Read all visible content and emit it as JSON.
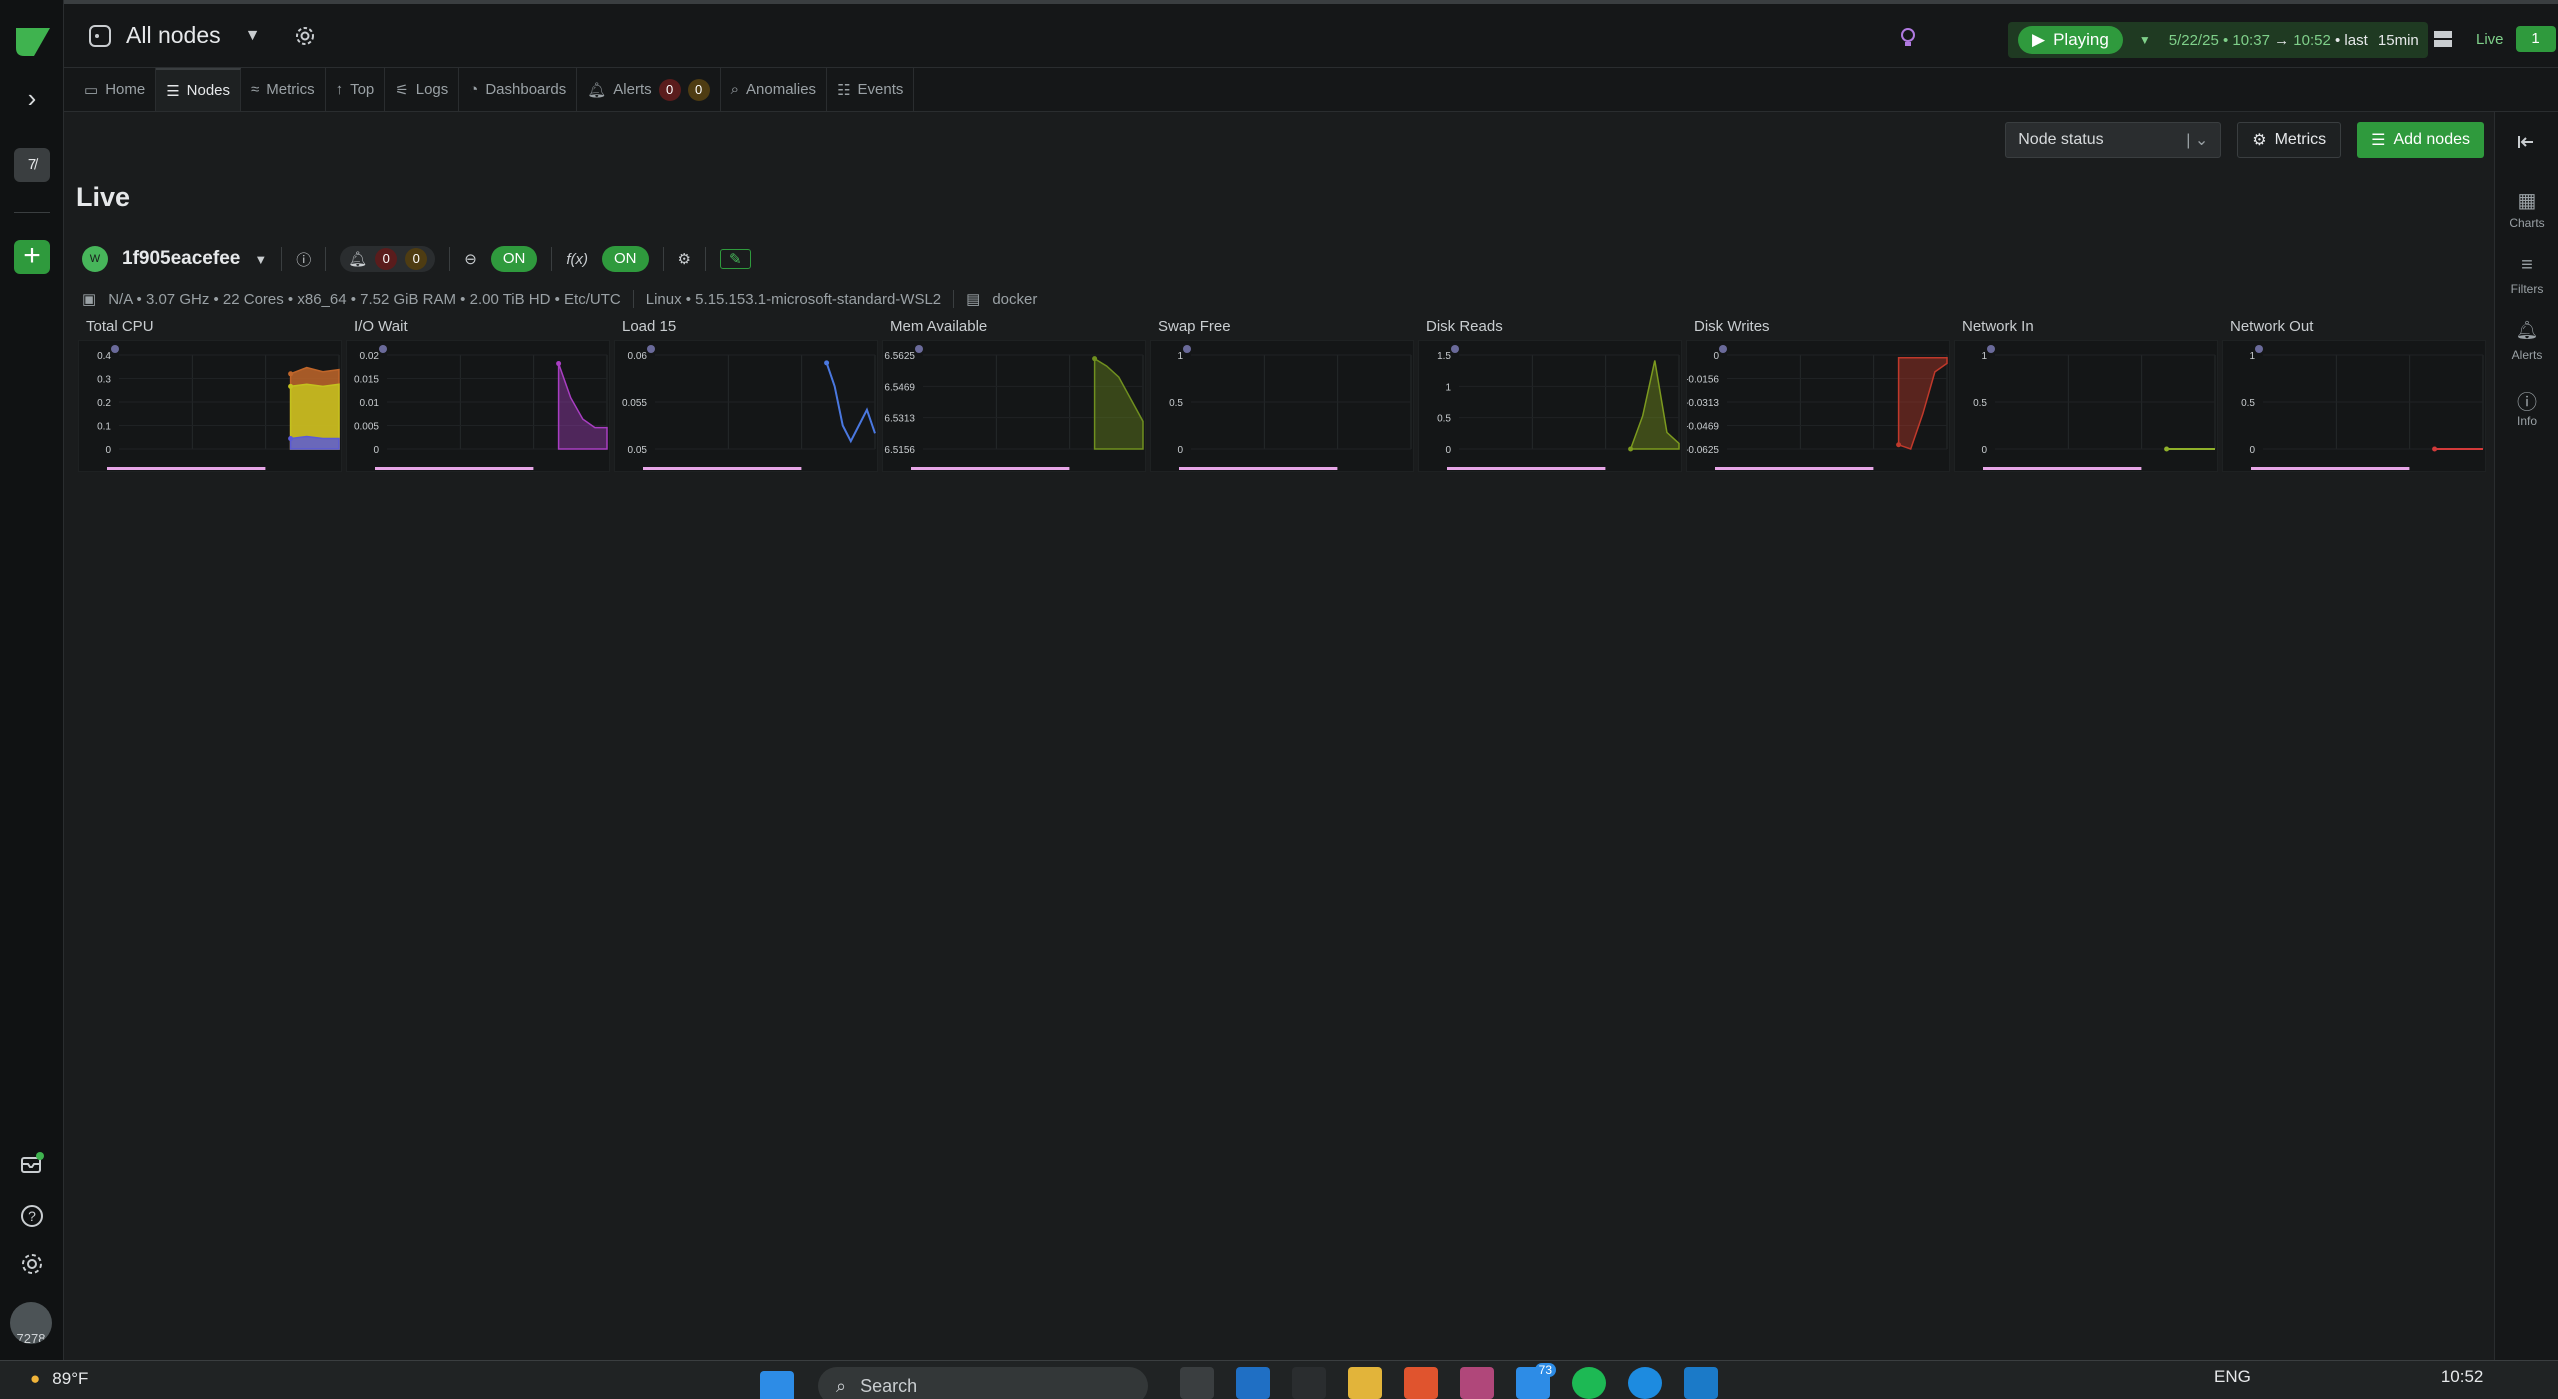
{
  "topbar": {
    "rooms_title": "All nodes",
    "playing_label": "Playing",
    "range_date": "5/22/25 •",
    "range_from": "10:37",
    "range_arrow": "→",
    "range_to": "10:52",
    "range_suffix": "• last",
    "range_window": "15min",
    "live_label": "Live",
    "live_count": "1"
  },
  "tabs": [
    {
      "label": "Home",
      "icon": "monitor-icon"
    },
    {
      "label": "Nodes",
      "icon": "nodes-icon"
    },
    {
      "label": "Metrics",
      "icon": "metrics-icon"
    },
    {
      "label": "Top",
      "icon": "arrow-up-icon"
    },
    {
      "label": "Logs",
      "icon": "logs-icon"
    },
    {
      "label": "Dashboards",
      "icon": "dashboard-icon"
    },
    {
      "label": "Alerts",
      "icon": "bell-icon"
    },
    {
      "label": "Anomalies",
      "icon": "anomaly-icon"
    },
    {
      "label": "Events",
      "icon": "events-icon"
    }
  ],
  "alerts": {
    "critical": "0",
    "warning": "0"
  },
  "rail": {
    "space_badge": "7̸",
    "avatar_text": "7278"
  },
  "toolbar": {
    "select_value": "Node status",
    "metrics_button": "Metrics",
    "add_nodes_button": "Add nodes"
  },
  "page_title": "Live",
  "node": {
    "avatar_text": "W",
    "name": "1f905eacefee",
    "alerts_critical": "0",
    "alerts_warning": "0",
    "zoom_toggle": "ON",
    "fx_toggle": "ON",
    "fx_label": "f(x)",
    "meta_hw": "N/A • 3.07 GHz • 22 Cores • x86_64 • 7.52 GiB RAM • 2.00 TiB HD • Etc/UTC",
    "meta_os": "Linux • 5.15.153.1-microsoft-standard-WSL2",
    "meta_container": "docker"
  },
  "chart_data": [
    {
      "type": "area",
      "title": "Total CPU",
      "yticks": [
        "0.4",
        "0.3",
        "0.2",
        "0.1",
        "0"
      ],
      "ylim": [
        0,
        0.45
      ],
      "color": "#5b5bd6",
      "series": [
        {
          "values": [
            0.05,
            0.06,
            0.05,
            0.05
          ]
        },
        {
          "values": [
            0.3,
            0.31,
            0.3,
            0.31
          ]
        },
        {
          "values": [
            0.36,
            0.39,
            0.37,
            0.38
          ]
        }
      ],
      "stack_colors": [
        "#5b5bd6",
        "#c4c21e",
        "#c0662a"
      ]
    },
    {
      "type": "area",
      "title": "I/O Wait",
      "yticks": [
        "0.02",
        "0.015",
        "0.01",
        "0.005",
        "0"
      ],
      "ylim": [
        0,
        0.022
      ],
      "color": "#a83ec2",
      "series": [
        {
          "values": [
            0.02,
            0.012,
            0.007,
            0.005,
            0.005
          ]
        }
      ]
    },
    {
      "type": "line",
      "title": "Load 15",
      "yticks": [
        "0.06",
        "0.055",
        "0.05"
      ],
      "ylim": [
        0.049,
        0.061
      ],
      "color": "#4a78e0",
      "series": [
        {
          "values": [
            0.06,
            0.057,
            0.052,
            0.05,
            0.052,
            0.054,
            0.051
          ]
        }
      ]
    },
    {
      "type": "area",
      "title": "Mem Available",
      "yticks": [
        "6.5625",
        "6.5469",
        "6.5313",
        "6.5156"
      ],
      "ylim": [
        6.513,
        6.564
      ],
      "color": "#6f8f1f",
      "series": [
        {
          "values": [
            6.562,
            6.558,
            6.552,
            6.54,
            6.528
          ]
        }
      ]
    },
    {
      "type": "line",
      "title": "Swap Free",
      "yticks": [
        "1",
        "0.5",
        "0"
      ],
      "ylim": [
        0,
        1.1
      ],
      "color": "#8f8f8f",
      "series": []
    },
    {
      "type": "area",
      "title": "Disk Reads",
      "yticks": [
        "1.5",
        "1",
        "0.5",
        "0"
      ],
      "ylim": [
        0,
        1.7
      ],
      "color": "#7c9a1f",
      "series": [
        {
          "values": [
            0,
            0.6,
            1.6,
            0.3,
            0.1
          ]
        }
      ]
    },
    {
      "type": "area",
      "title": "Disk Writes",
      "yticks": [
        "0",
        "-0.0156",
        "-0.0313",
        "-0.0469",
        "-0.0625"
      ],
      "ylim": [
        -0.065,
        0.002
      ],
      "color": "#c0392b",
      "series": [
        {
          "values": [
            -0.062,
            -0.065,
            -0.04,
            -0.01,
            -0.004
          ]
        }
      ]
    },
    {
      "type": "line",
      "title": "Network In",
      "yticks": [
        "1",
        "0.5",
        "0"
      ],
      "ylim": [
        0,
        1.1
      ],
      "color": "#8fb02a",
      "series": [
        {
          "values": [
            0,
            0,
            0,
            0
          ]
        }
      ]
    },
    {
      "type": "line",
      "title": "Network Out",
      "yticks": [
        "1",
        "0.5",
        "0"
      ],
      "ylim": [
        0,
        1.1
      ],
      "color": "#d23a3a",
      "series": [
        {
          "values": [
            0,
            0,
            0,
            0
          ]
        }
      ]
    }
  ],
  "right_rail": [
    {
      "label": "Charts",
      "icon": "charts-icon"
    },
    {
      "label": "Filters",
      "icon": "filter-icon"
    },
    {
      "label": "Alerts",
      "icon": "bell-icon"
    },
    {
      "label": "Info",
      "icon": "info-icon"
    }
  ],
  "taskbar": {
    "temperature": "89°F",
    "search_placeholder": "Search",
    "language": "ENG",
    "clock": "10:52",
    "mail_badge": "73"
  }
}
